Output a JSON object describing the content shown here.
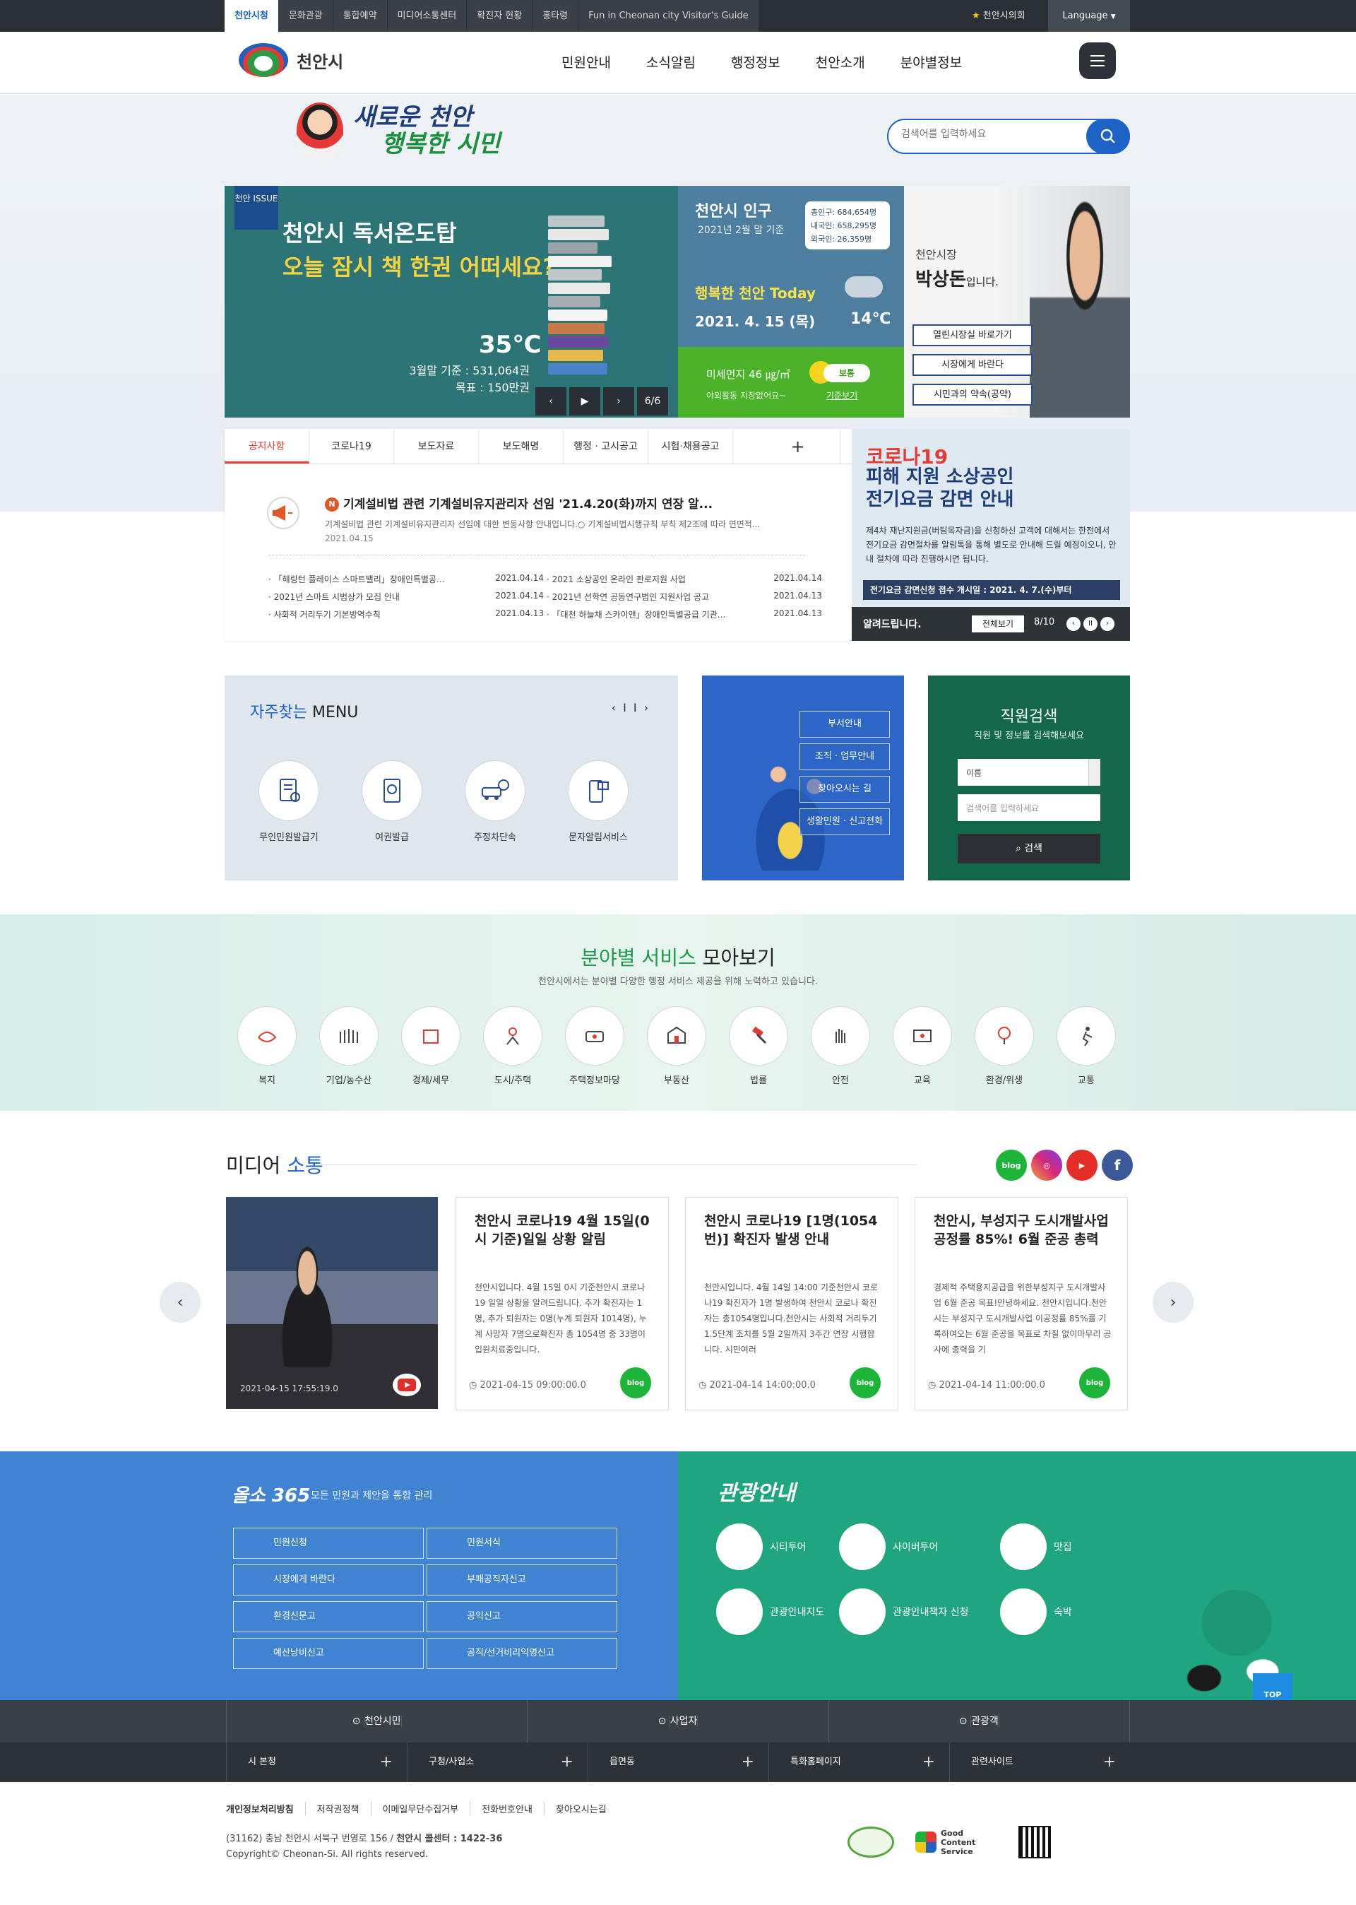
{
  "topbar": {
    "sites": [
      "천안시청",
      "문화관광",
      "통합예약",
      "미디어소통센터",
      "확진자 현황",
      "흥타령",
      "Fun in Cheonan city Visitor's Guide"
    ],
    "council": "천안시의회",
    "language": "Language"
  },
  "gnb": {
    "logo_text": "천안시",
    "menu": [
      "민원안내",
      "소식알림",
      "행정정보",
      "천안소개",
      "분야별정보"
    ]
  },
  "slogan": {
    "line1": "새로운 천안",
    "line2": "행복한 시민"
  },
  "search": {
    "placeholder": "검색어를 입력하세요"
  },
  "issue": {
    "tag": "천안 ISSUE",
    "title1": "천안시 독서온도탑",
    "title2": "오늘 잠시 책 한권 어떠세요?",
    "temp": "35℃",
    "base": "3월말 기준 : 531,064권",
    "goal": "목표 : 150만권",
    "page": "6/6"
  },
  "population": {
    "title": "천안시 인구",
    "date": "2021년 2월 말 기준",
    "total": "총인구: 684,654명",
    "korean": "내국인: 658,295명",
    "foreign": "외국인: 26,359명",
    "today": "행복한 천안 Today",
    "day": "2021. 4. 15 (목)",
    "temp": "14℃"
  },
  "dust": {
    "label": "미세먼지 46 ㎍/㎥",
    "status": "보통",
    "tip": "야외활동 지장없어요~",
    "std": "기준보기"
  },
  "mayor": {
    "role": "천안시장",
    "name": "박상돈",
    "suffix": "입니다.",
    "buttons": [
      "열린시장실 바로가기",
      "시장에게 바란다",
      "시민과의 약속(공약)"
    ]
  },
  "notice": {
    "tabs": [
      "공지사항",
      "코로나19",
      "보도자료",
      "보도해명",
      "행정 · 고시공고",
      "시험·채용공고"
    ],
    "headline": "기계설비법 관련 기계설비유지관리자 선임 '21.4.20(화)까지 연장 알...",
    "desc": "기계설비법 관련 기계설비유지관리자 선임에 대한 변동사항 안내입니다.○ 기계설비법시행규칙 부칙 제2조에 따라 연면적...",
    "date": "2021.04.15",
    "left": [
      {
        "t": "「해링턴 플레이스 스마트밸리」장애인특별공...",
        "d": "2021.04.14"
      },
      {
        "t": "2021년 스마트 시범상가 모집 안내",
        "d": "2021.04.14"
      },
      {
        "t": "사회적 거리두기 기본방역수칙",
        "d": "2021.04.13"
      }
    ],
    "right": [
      {
        "t": "2021 소상공인 온라인 판로지원 사업",
        "d": "2021.04.14"
      },
      {
        "t": "2021년 선학연 공동연구법인 지원사업 공고",
        "d": "2021.04.13"
      },
      {
        "t": "「대천 하늘채 스카이앤」장애인특별공급 기관...",
        "d": "2021.04.13"
      }
    ]
  },
  "covid": {
    "t1": "코로나19",
    "t2a": "피해 지원 소상공인",
    "t2b": "전기요금 감면 안내",
    "text": "제4차 재난지원금(버팀목자금)을 신청하신 고객에 대해서는 한전에서 전기요금 감면절차를 알림톡을 통해 별도로 안내해 드릴 예정이오니, 안내 절차에 따라 진행하시면 됩니다.",
    "date": "전기요금 감면신청 접수 개시일 : 2021. 4. 7.(수)부터",
    "bar": "알려드립니다.",
    "all": "전체보기",
    "page": "8/10"
  },
  "freq": {
    "title_a": "자주찾는",
    "title_b": "MENU",
    "items": [
      "무인민원발급기",
      "여권발급",
      "주정차단속",
      "문자알림서비스"
    ]
  },
  "dept": {
    "buttons": [
      "부서안내",
      "조직 · 업무안내",
      "찾아오시는 길",
      "생활민원 · 신고전화"
    ]
  },
  "staff": {
    "title": "직원검색",
    "sub": "직원 및 정보를 검색해보세요",
    "select": "이름",
    "placeholder": "검색어를 입력하세요",
    "button": "검색"
  },
  "fields": {
    "title_a": "분야별 서비스",
    "title_b": "모아보기",
    "sub": "천안시에서는 분야별 다양한 행정 서비스 제공을 위해 노력하고 있습니다.",
    "items": [
      "복지",
      "기업/농수산",
      "경제/세무",
      "도시/주택",
      "주택정보마당",
      "부동산",
      "법률",
      "안전",
      "교육",
      "환경/위생",
      "교통"
    ]
  },
  "media": {
    "title_a": "미디어",
    "title_b": "소통",
    "video_date": "2021-04-15 17:55:19.0",
    "cards": [
      {
        "title": "천안시 코로나19 4월 15일(0시 기준)일일 상황 알림",
        "body": "천안시입니다. 4월 15일 0시 기준천안시 코로나19 일일 상황을 알려드립니다. 추가 확진자는 1명, 추가 퇴원자는 0명(누계 퇴원자 1014명), 누계 사망자 7명으로확진자 총 1054명 중 33명이 입원치료중입니다.",
        "date": "2021-04-15 09:00:00.0"
      },
      {
        "title": "천안시 코로나19 [1명(1054번)] 확진자 발생 안내",
        "body": "천안시입니다. 4월 14일 14:00 기준천안시 코로나19 확진자가 1명 발생하여 천안시 코로나 확진자는 총1054명입니다.천안시는 사회적 거리두기 1.5단계 조치를 5월 2일까지 3주간 연장 시행합니다. 시민여러",
        "date": "2021-04-14 14:00:00.0"
      },
      {
        "title": "천안시, 부성지구 도시개발사업 공정률 85%! 6월 준공 총력",
        "body": "경제적 주택용지공급을 위한부성지구 도시개발사업 6월 준공 목표!안녕하세요. 천안시입니다.천안시는 부성지구 도시개발사업 이공정률 85%를 기록하여오는 6월 준공을 목표로 차질 없이마무리 공사에 총력을 기",
        "date": "2021-04-14 11:00:00.0"
      }
    ],
    "blog": "blog"
  },
  "s365": {
    "title": "올소 365",
    "sub": "모든 민원과 제안을 통합 관리",
    "items": [
      "민원신청",
      "민원서식",
      "시장에게 바란다",
      "부패공직자신고",
      "환경신문고",
      "공익신고",
      "예산낭비신고",
      "공직/선거비리익명신고"
    ]
  },
  "tour": {
    "title": "관광안내",
    "items": [
      "시티투어",
      "사이버투어",
      "맛집",
      "관광안내지도",
      "관광안내책자 신청",
      "숙박"
    ]
  },
  "top_label": "TOP",
  "fbar1": [
    "천안시민",
    "사업자",
    "관광객"
  ],
  "fbar2": [
    "시 본청",
    "구청/사업소",
    "읍면동",
    "특화홈페이지",
    "관련사이트"
  ],
  "footer": {
    "links": [
      "개인정보처리방침",
      "저작권정책",
      "이메일무단수집거부",
      "전화번호안내",
      "찾아오시는길"
    ],
    "addr_a": "(31162) 충남 천안시 서북구 번영로 156 / ",
    "addr_b": "천안시 콜센터 : 1422-36",
    "copy": "Copyright© Cheonan-Si. All rights reserved.",
    "gcs": "Good Content Service"
  },
  "colors": {
    "primary": "#1c63c5",
    "green": "#13674a",
    "red": "#e53935"
  }
}
